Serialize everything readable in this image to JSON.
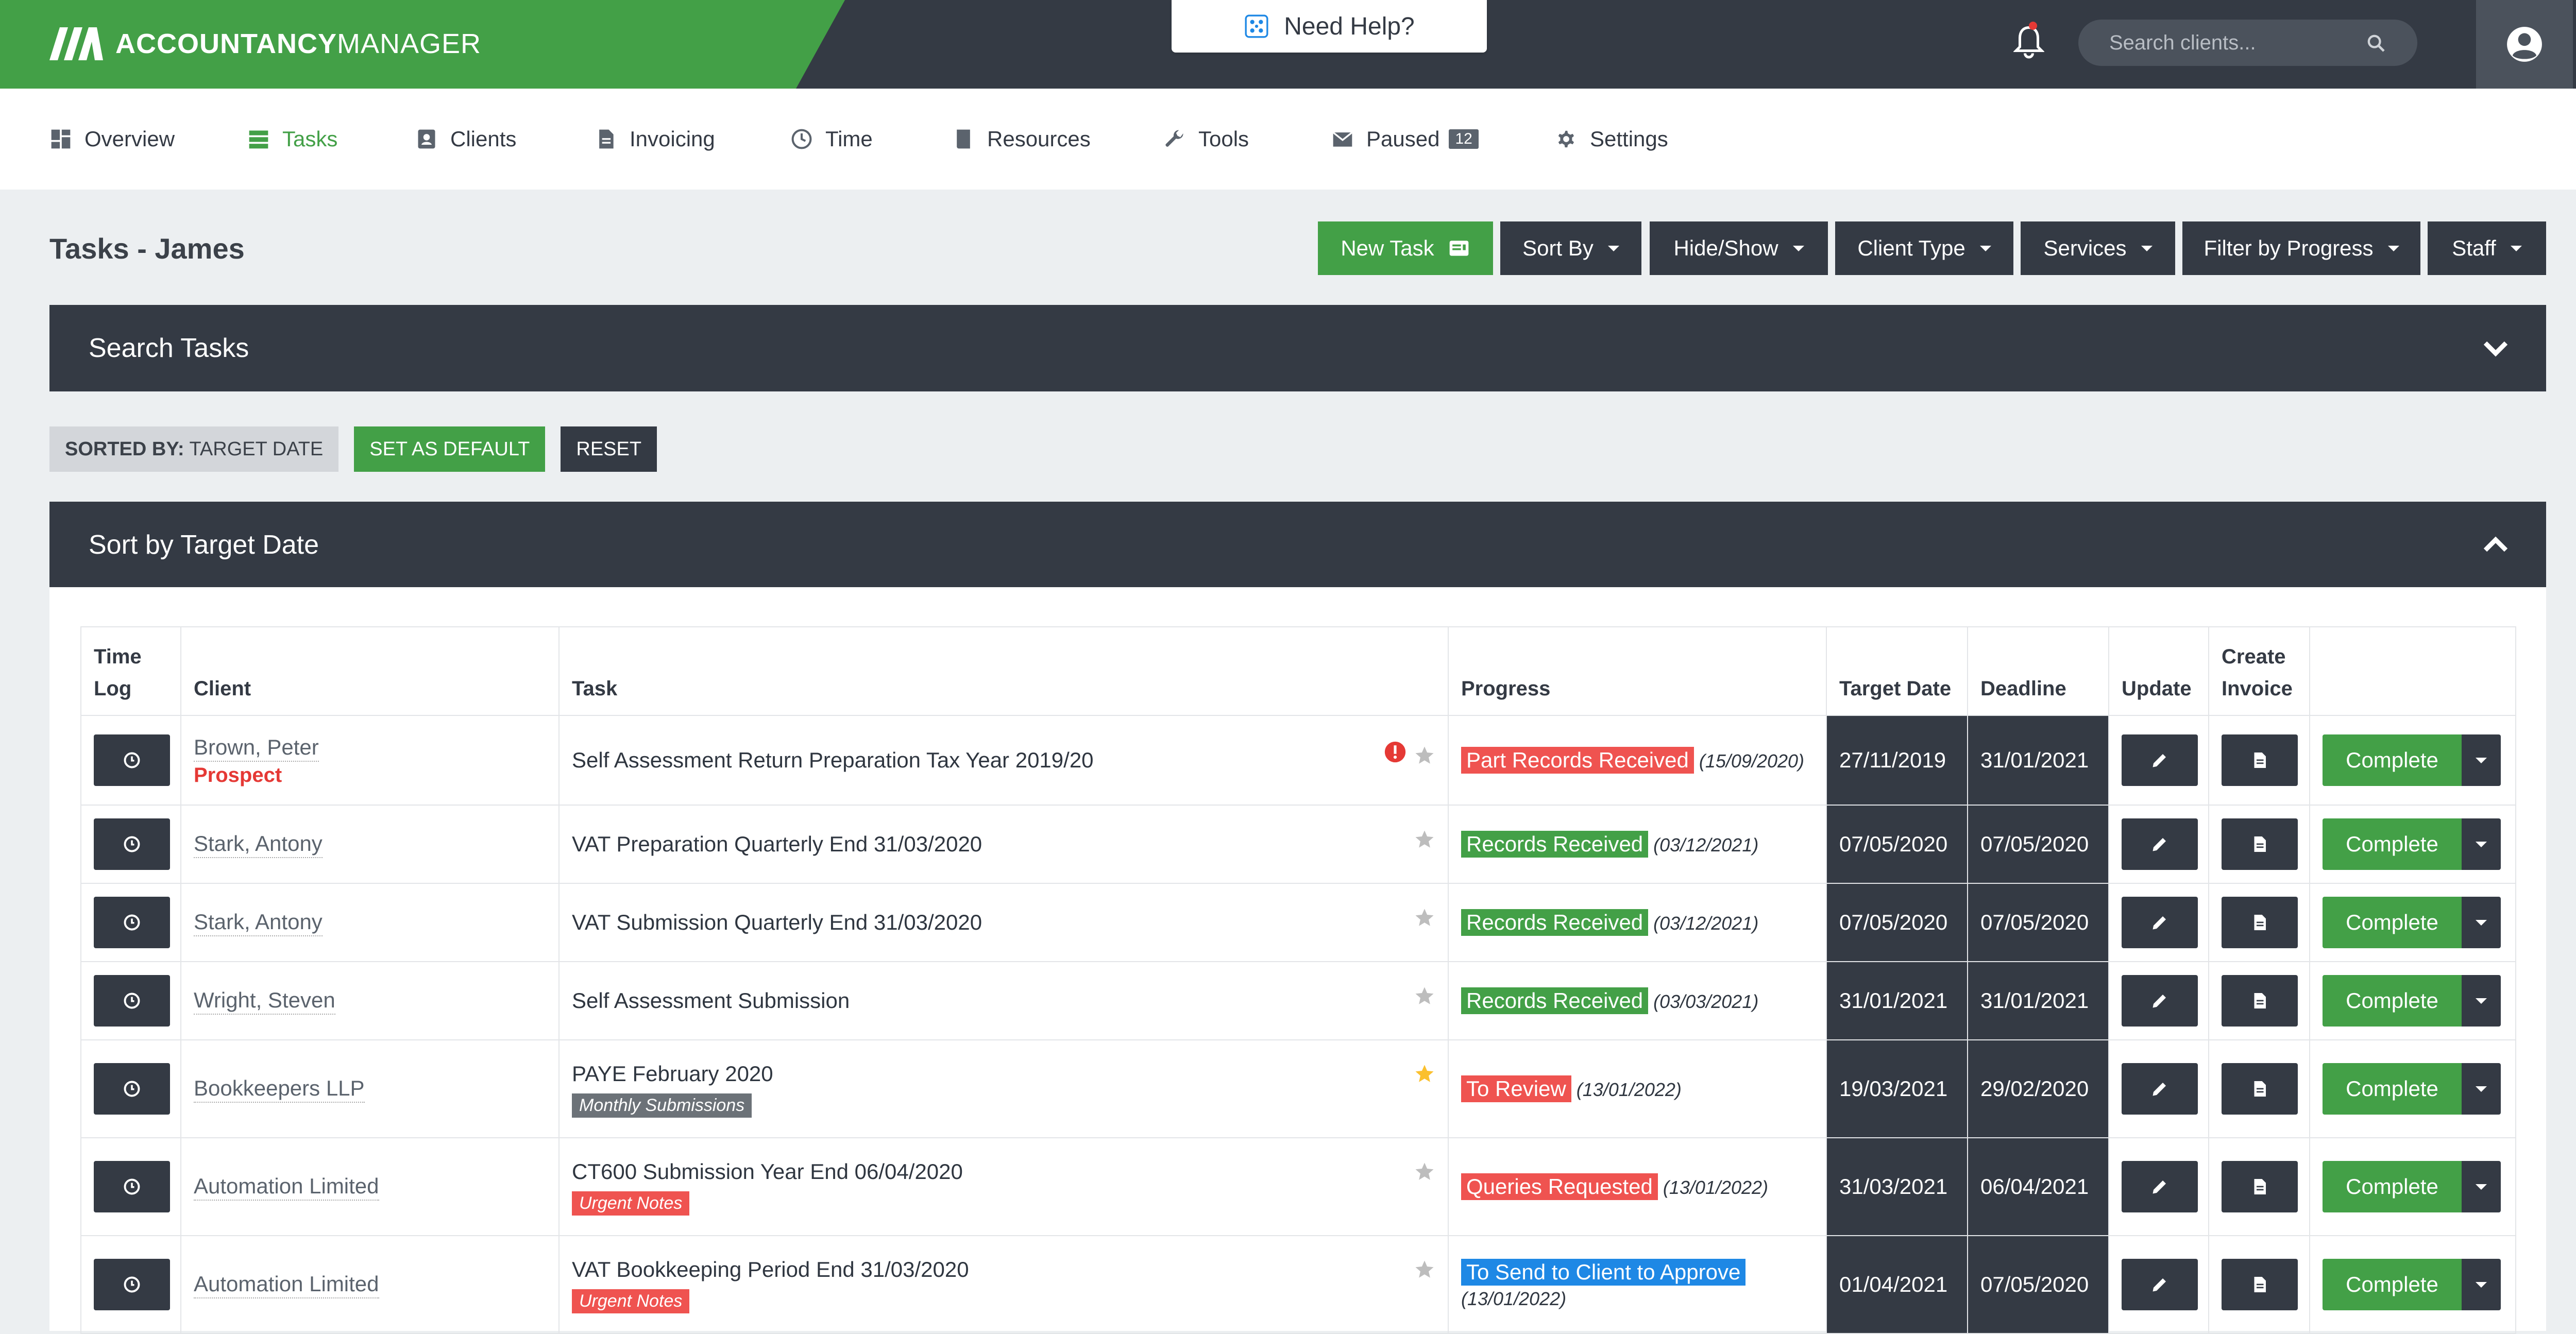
{
  "app": {
    "brand_bold": "ACCOUNTANCY",
    "brand_light": "MANAGER",
    "help_label": "Need Help?"
  },
  "header": {
    "search_placeholder": "Search clients..."
  },
  "nav": [
    {
      "label": "Overview",
      "icon": "dashboard-icon"
    },
    {
      "label": "Tasks",
      "icon": "tasks-icon",
      "active": true
    },
    {
      "label": "Clients",
      "icon": "contacts-icon"
    },
    {
      "label": "Invoicing",
      "icon": "document-icon"
    },
    {
      "label": "Time",
      "icon": "clock-icon"
    },
    {
      "label": "Resources",
      "icon": "book-icon"
    },
    {
      "label": "Tools",
      "icon": "wrench-icon"
    },
    {
      "label": "Paused",
      "icon": "mail-icon",
      "badge": "12"
    },
    {
      "label": "Settings",
      "icon": "gear-icon"
    }
  ],
  "page": {
    "title": "Tasks - James"
  },
  "toolbar": {
    "new_task": "New Task",
    "sort_by": "Sort By",
    "hide_show": "Hide/Show",
    "client_type": "Client Type",
    "services": "Services",
    "filter_progress": "Filter by Progress",
    "staff": "Staff"
  },
  "search_panel": {
    "title": "Search Tasks"
  },
  "sorted": {
    "prefix": "SORTED BY:",
    "value": "TARGET DATE",
    "set_default": "SET AS DEFAULT",
    "reset": "RESET"
  },
  "sort_panel": {
    "title": "Sort by Target Date"
  },
  "table": {
    "headers": {
      "time_log_1": "Time",
      "time_log_2": "Log",
      "client": "Client",
      "task": "Task",
      "progress": "Progress",
      "target_date": "Target Date",
      "deadline": "Deadline",
      "update": "Update",
      "create_invoice_1": "Create",
      "create_invoice_2": "Invoice"
    },
    "complete_label": "Complete",
    "rows": [
      {
        "client": "Brown, Peter",
        "prospect": "Prospect",
        "task": "Self Assessment Return Preparation Tax Year 2019/20",
        "tag": "",
        "alert": true,
        "starred": false,
        "progress": "Part Records Received",
        "progress_color": "#ef5350",
        "progress_date": "(15/09/2020)",
        "target": "27/11/2019",
        "deadline": "31/01/2021"
      },
      {
        "client": "Stark, Antony",
        "prospect": "",
        "task": "VAT Preparation Quarterly End 31/03/2020",
        "tag": "",
        "alert": false,
        "starred": false,
        "progress": "Records Received",
        "progress_color": "#43a047",
        "progress_date": "(03/12/2021)",
        "target": "07/05/2020",
        "deadline": "07/05/2020"
      },
      {
        "client": "Stark, Antony",
        "prospect": "",
        "task": "VAT Submission Quarterly End 31/03/2020",
        "tag": "",
        "alert": false,
        "starred": false,
        "progress": "Records Received",
        "progress_color": "#43a047",
        "progress_date": "(03/12/2021)",
        "target": "07/05/2020",
        "deadline": "07/05/2020"
      },
      {
        "client": "Wright, Steven",
        "prospect": "",
        "task": "Self Assessment Submission",
        "tag": "",
        "alert": false,
        "starred": false,
        "progress": "Records Received",
        "progress_color": "#43a047",
        "progress_date": "(03/03/2021)",
        "target": "31/01/2021",
        "deadline": "31/01/2021"
      },
      {
        "client": "Bookkeepers LLP",
        "prospect": "",
        "task": "PAYE February 2020",
        "tag": "Monthly Submissions",
        "tag_color": "grey",
        "alert": false,
        "starred": true,
        "progress": "To Review",
        "progress_color": "#ef5350",
        "progress_date": "(13/01/2022)",
        "target": "19/03/2021",
        "deadline": "29/02/2020"
      },
      {
        "client": "Automation Limited",
        "prospect": "",
        "task": "CT600 Submission Year End 06/04/2020",
        "tag": "Urgent Notes",
        "tag_color": "red",
        "alert": false,
        "starred": false,
        "progress": "Queries Requested",
        "progress_color": "#ef5350",
        "progress_date": "(13/01/2022)",
        "target": "31/03/2021",
        "deadline": "06/04/2021"
      },
      {
        "client": "Automation Limited",
        "prospect": "",
        "task": "VAT Bookkeeping Period End 31/03/2020",
        "tag": "Urgent Notes",
        "tag_color": "red",
        "alert": false,
        "starred": false,
        "progress": "To Send to Client to Approve",
        "progress_color": "#1e88e5",
        "progress_date": "(13/01/2022)",
        "progress_date_newline": true,
        "target": "01/04/2021",
        "deadline": "07/05/2020"
      }
    ]
  },
  "colors": {
    "brand_green": "#43a047",
    "dark": "#343a44",
    "alert_red": "#e53935",
    "star_gold": "#fbc02d"
  }
}
